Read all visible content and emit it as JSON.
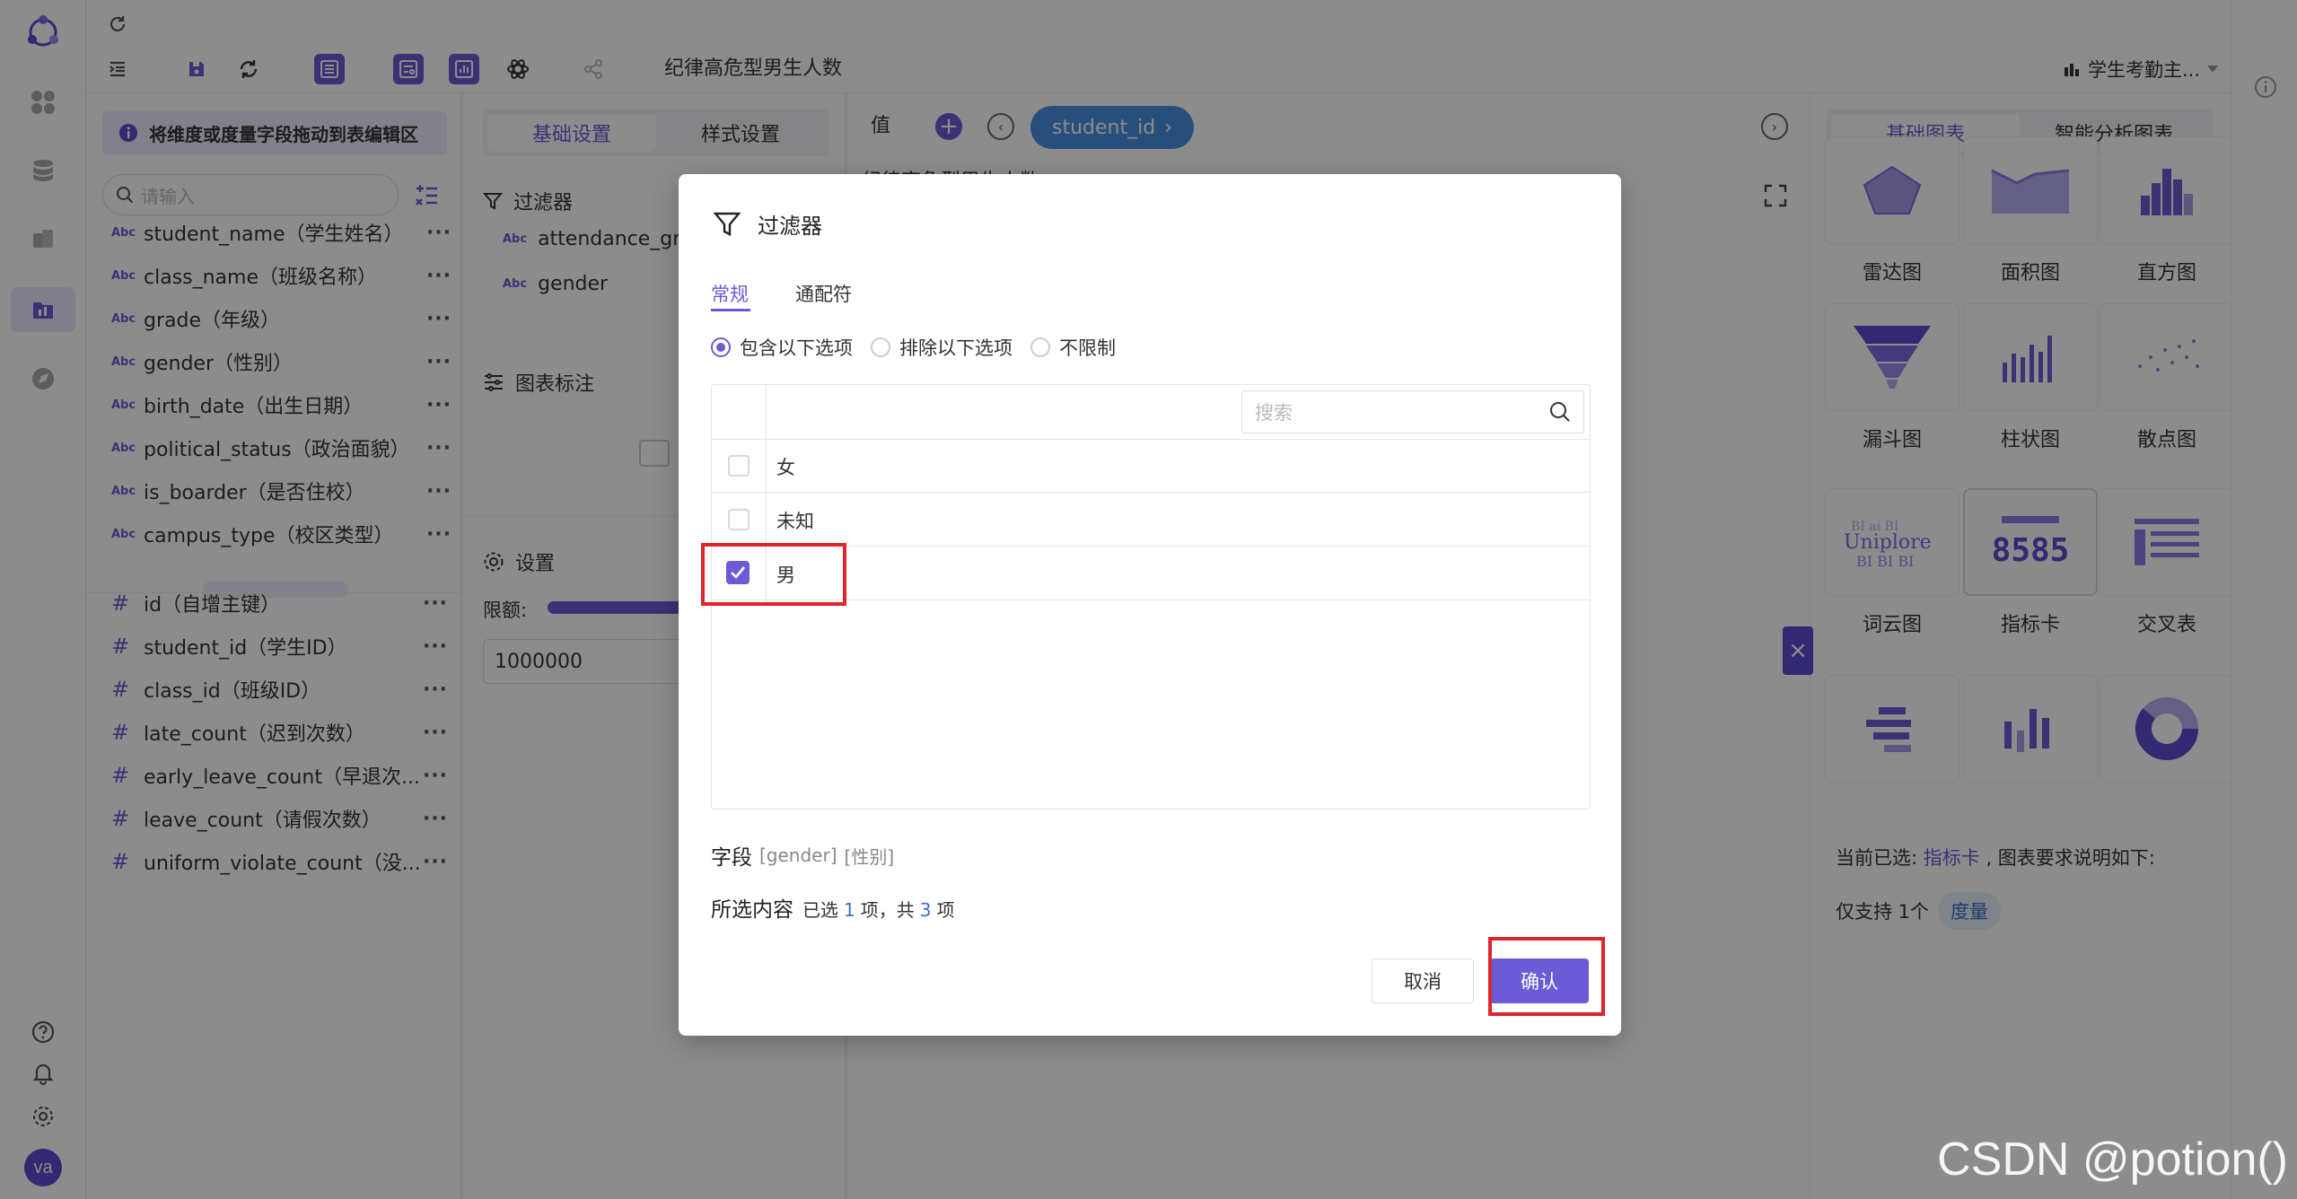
{
  "topbar": {
    "chart_title": "纪律高危型男生人数",
    "dataset_name": "学生考勤主..."
  },
  "field_panel": {
    "hint": "将维度或度量字段拖动到表编辑区",
    "search_placeholder": "请输入",
    "dimension_tag": "Abc",
    "measure_tag": "#",
    "more": "···",
    "dimensions": [
      "student_name（学生姓名）",
      "class_name（班级名称）",
      "grade（年级）",
      "gender（性别）",
      "birth_date（出生日期）",
      "political_status（政治面貌）",
      "is_boarder（是否住校）",
      "campus_type（校区类型）"
    ],
    "measures": [
      "id（自增主键）",
      "student_id（学生ID）",
      "class_id（班级ID）",
      "late_count（迟到次数）",
      "early_leave_count（早退次...",
      "leave_count（请假次数）",
      "uniform_violate_count（没..."
    ]
  },
  "mid_panel": {
    "tabs": [
      "基础设置",
      "样式设置"
    ],
    "filter_label": "过滤器",
    "filter_fields": [
      "attendance_gro",
      "gender"
    ],
    "annotation_label": "图表标注",
    "settings_label": "设置",
    "limit_label": "限额:",
    "limit_value": "1000000"
  },
  "canvas": {
    "value_label": "值",
    "value_chip": "student_id",
    "partial_title": "纪律高危型男生人数"
  },
  "right_panel": {
    "tabs": [
      "基础图表",
      "智能分析图表"
    ],
    "charts": [
      {
        "label": "雷达图",
        "icon": "radar-chart-icon"
      },
      {
        "label": "面积图",
        "icon": "area-chart-icon"
      },
      {
        "label": "直方图",
        "icon": "histogram-icon"
      },
      {
        "label": "漏斗图",
        "icon": "funnel-chart-icon"
      },
      {
        "label": "柱状图",
        "icon": "bar-chart-icon"
      },
      {
        "label": "散点图",
        "icon": "scatter-chart-icon"
      },
      {
        "label": "词云图",
        "icon": "word-cloud-icon"
      },
      {
        "label": "指标卡",
        "icon": "metric-card-icon",
        "number": "8585"
      },
      {
        "label": "交叉表",
        "icon": "cross-table-icon"
      },
      {
        "label": "",
        "icon": "horizontal-bar-icon"
      },
      {
        "label": "",
        "icon": "vertical-bar-icon"
      },
      {
        "label": "",
        "icon": "donut-chart-icon"
      }
    ],
    "current_prefix": "当前已选:",
    "current_chart": "指标卡",
    "current_suffix": ", 图表要求说明如下:",
    "support_prefix": "仅支持 1个",
    "support_tag": "度量"
  },
  "modal": {
    "title": "过滤器",
    "tabs": [
      "常规",
      "通配符"
    ],
    "radios": [
      {
        "label": "包含以下选项",
        "selected": true
      },
      {
        "label": "排除以下选项",
        "selected": false
      },
      {
        "label": "不限制",
        "selected": false
      }
    ],
    "search_placeholder": "搜索",
    "options": [
      {
        "label": "女",
        "checked": false
      },
      {
        "label": "未知",
        "checked": false
      },
      {
        "label": "男",
        "checked": true
      }
    ],
    "field_label": "字段",
    "field_name": "[gender]",
    "field_alias": "[性别]",
    "selected_label": "所选内容",
    "selected_prefix": "已选",
    "selected_count": "1",
    "selected_mid": "项，共",
    "total_count": "3",
    "selected_suffix": "项",
    "cancel_label": "取消",
    "confirm_label": "确认"
  },
  "sidebar": {
    "avatar": "va"
  },
  "watermark": "CSDN @potion()",
  "colors": {
    "accent": "#6b5bd6",
    "highlight": "#e0242c",
    "overlay": "rgba(0,0,0,0.45)"
  }
}
